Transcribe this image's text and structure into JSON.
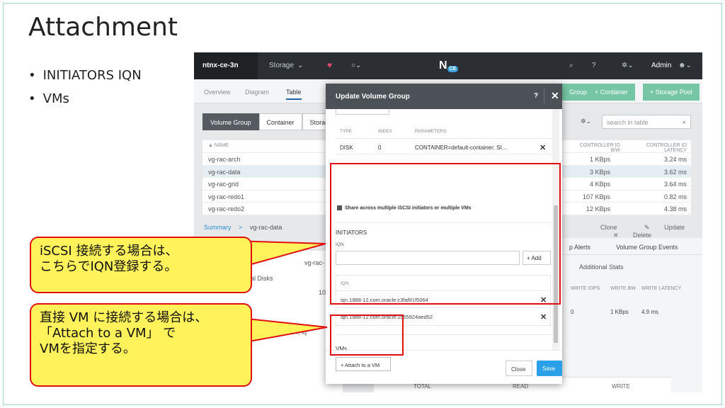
{
  "slide": {
    "title": "Attachment",
    "bullets": [
      "INITIATORS IQN",
      "VMs"
    ]
  },
  "topbar": {
    "cluster": "ntnx-ce-3n",
    "menu": "Storage",
    "logo": "N",
    "logo_badge": "CE",
    "help": "?",
    "user": "Admin"
  },
  "subnav": {
    "views": [
      "Overview",
      "Diagram",
      "Table"
    ],
    "buttons": [
      "+ Container",
      "+ Storage Pool"
    ],
    "partial_button": "Group"
  },
  "tabs": [
    "Volume Group",
    "Container",
    "Storag"
  ],
  "search": {
    "placeholder": "search in table"
  },
  "table": {
    "headers": {
      "name": "NAME",
      "bw": "CONTROLLER IO B/W",
      "latency": "CONTROLLER IO LATENCY"
    },
    "rows": [
      {
        "name": "vg-rac-arch",
        "bw": "1 KBps",
        "latency": "3.24 ms"
      },
      {
        "name": "vg-rac-data",
        "bw": "3 KBps",
        "latency": "3.62 ms"
      },
      {
        "name": "vg-rac-grid",
        "bw": "4 KBps",
        "latency": "3.64 ms"
      },
      {
        "name": "vg-rac-redo1",
        "bw": "107 KBps",
        "latency": "0.82 ms"
      },
      {
        "name": "vg-rac-redo2",
        "bw": "12 KBps",
        "latency": "4.38 ms"
      }
    ]
  },
  "summary": {
    "label": "Summary",
    "sep": ">",
    "item": "vg-rac-data"
  },
  "actions": {
    "clone": "Clone",
    "update": "Update",
    "delete": "Delete"
  },
  "lower_left": {
    "vg": "vg-rac-",
    "disks": "al Disks",
    "num": "10",
    "iqn_frag": "afa81f5064, iq"
  },
  "lower_right": {
    "tabs": [
      "p Alerts",
      "Volume Group Events"
    ],
    "stats_title": "Additional Stats",
    "cols": [
      "WRITE IOPS",
      "WRITE BW",
      "WRITE LATENCY"
    ],
    "vals": [
      "0",
      "1 KBps",
      "4.9 ms"
    ]
  },
  "bottom_bar": [
    "TOTAL",
    "READ",
    "WRITE"
  ],
  "modal": {
    "title": "Update Volume Group",
    "help": "?",
    "disk_table": {
      "headers": [
        "TYPE",
        "INDEX",
        "PARAMETERS"
      ],
      "row": [
        "DISK",
        "0",
        "CONTAINER=default-container; SI..."
      ]
    },
    "share_label": "Share across multiple iSCSI initiators or multiple VMs",
    "initiators_title": "INITIATORS",
    "iqn_label": "IQN",
    "add_label": "+ Add",
    "iqn_list_header": "IQN",
    "iqns": [
      "iqn.1988-12.com.oracle:c3faf81f5064",
      "iqn.1988-12.com.oracle:2c55924aed52"
    ],
    "vms_title": "VMs",
    "attach_label": "+ Attach to a VM",
    "close_label": "Close",
    "save_label": "Save"
  },
  "callouts": {
    "iscsi": [
      "iSCSI 接続する場合は、",
      "こちらでIQN登録する。"
    ],
    "vm": [
      "直接 VM に接続する場合は、",
      "「Attach to a VM」 で",
      "VMを指定する。"
    ]
  },
  "colors": {
    "highlight": "#e01010",
    "callout_fill": "#fff25a",
    "accent": "#2aa0e8"
  }
}
